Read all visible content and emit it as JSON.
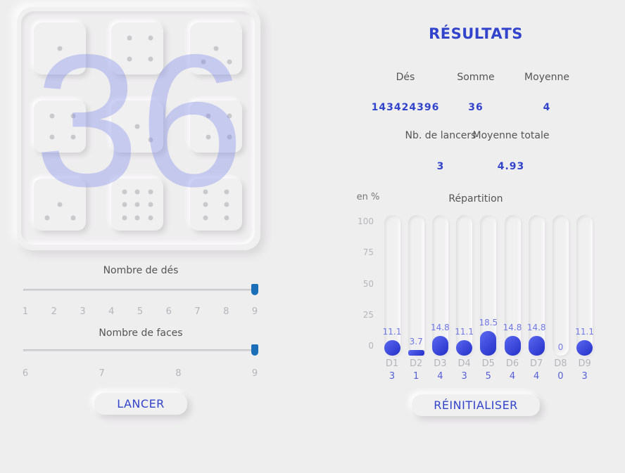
{
  "dice_board": {
    "dice": [
      1,
      4,
      3,
      4,
      2,
      4,
      3,
      9,
      6
    ],
    "big_sum": "36"
  },
  "sliders": {
    "dice_count": {
      "title": "Nombre de dés",
      "ticks": [
        "1",
        "2",
        "3",
        "4",
        "5",
        "6",
        "7",
        "8",
        "9"
      ],
      "value": 9,
      "min": 1,
      "max": 9
    },
    "faces_count": {
      "title": "Nombre de faces",
      "ticks": [
        "6",
        "7",
        "8",
        "9"
      ],
      "value": 9,
      "min": 6,
      "max": 9
    }
  },
  "buttons": {
    "roll": "LANCER",
    "reset": "RÉINITIALISER"
  },
  "results": {
    "title": "RÉSULTATS",
    "dice_label": "Dés",
    "dice_value": "143424396",
    "sum_label": "Somme",
    "sum_value": "36",
    "mean_label": "Moyenne",
    "mean_value": "4",
    "rolls_label": "Nb. de lancers",
    "rolls_value": "3",
    "total_mean_label": "Moyenne totale",
    "total_mean_value": "4.93"
  },
  "chart_data": {
    "type": "bar",
    "title": "Répartition",
    "ylabel": "en %",
    "ylim": [
      0,
      100
    ],
    "yticks": [
      "100",
      "75",
      "50",
      "25",
      "0"
    ],
    "categories": [
      "D1",
      "D2",
      "D3",
      "D4",
      "D5",
      "D6",
      "D7",
      "D8",
      "D9"
    ],
    "percent_labels": [
      "11.1",
      "3.7",
      "14.8",
      "11.1",
      "18.5",
      "14.8",
      "14.8",
      "0",
      "11.1"
    ],
    "values": [
      11.1,
      3.7,
      14.8,
      11.1,
      18.5,
      14.8,
      14.8,
      0,
      11.1
    ],
    "counts": [
      "3",
      "1",
      "4",
      "3",
      "5",
      "4",
      "4",
      "0",
      "3"
    ],
    "accent_color": "#3344cc"
  }
}
